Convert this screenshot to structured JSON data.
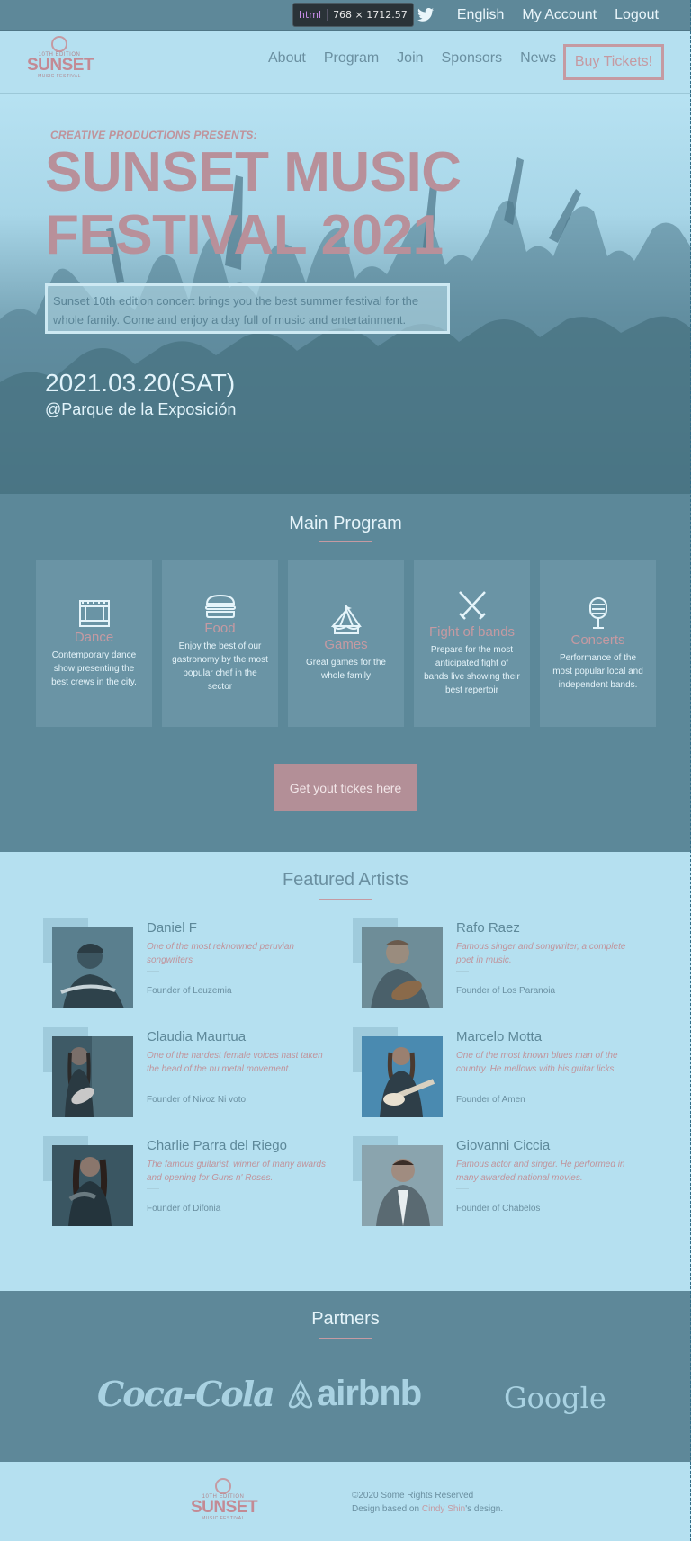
{
  "devtools": {
    "tag": "html",
    "dims": "768 × 1712.57"
  },
  "topbar": {
    "social": [
      "facebook-icon",
      "twitter-icon"
    ],
    "language": "English",
    "account": "My Account",
    "logout": "Logout"
  },
  "logo": {
    "edition": "10TH EDITION",
    "name": "SUNSET",
    "sub": "MUSIC FESTIVAL"
  },
  "nav": {
    "items": [
      "About",
      "Program",
      "Join",
      "Sponsors",
      "News"
    ],
    "buy": "Buy Tickets!"
  },
  "hero": {
    "pre": "CREATIVE PRODUCTIONS PRESENTS:",
    "title_line1": "SUNSET MUSIC",
    "title_line2": "FESTIVAL 2021",
    "blurb": "Sunset 10th edition concert brings you the best summer festival for the whole family. Come and enjoy a day full of music and entertainment.",
    "date": "2021.03.20(SAT)",
    "venue": "@Parque de la Exposición"
  },
  "program": {
    "title": "Main Program",
    "cards": [
      {
        "icon": "stage-icon",
        "title": "Dance",
        "desc": "Contemporary dance show presenting the best crews in the city."
      },
      {
        "icon": "burger-icon",
        "title": "Food",
        "desc": "Enjoy the best of our gastronomy by the most popular chef in the sector"
      },
      {
        "icon": "circus-tent-icon",
        "title": "Games",
        "desc": "Great games for the whole family"
      },
      {
        "icon": "crossed-swords-icon",
        "title": "Fight of bands",
        "desc": "Prepare for the most anticipated fight of bands live showing their best repertoir"
      },
      {
        "icon": "microphone-icon",
        "title": "Concerts",
        "desc": "Performance of the most popular local and independent bands."
      }
    ],
    "cta": "Get yout tickes here"
  },
  "artists": {
    "title": "Featured Artists",
    "items": [
      {
        "name": "Daniel F",
        "desc": "One of the most reknowned peruvian songwriters",
        "founder": "Founder of Leuzemia"
      },
      {
        "name": "Rafo Raez",
        "desc": "Famous singer and songwriter, a complete poet in music.",
        "founder": "Founder of Los Paranoia"
      },
      {
        "name": "Claudia Maurtua",
        "desc": "One of the hardest female voices hast taken the head of the nu metal movement.",
        "founder": "Founder of Nivoz Ni voto"
      },
      {
        "name": "Marcelo Motta",
        "desc": "One of the most known blues man of the country. He mellows with his guitar licks.",
        "founder": "Founder of Amen"
      },
      {
        "name": "Charlie Parra del Riego",
        "desc": "The famous guitarist, winner of many awards and opening for Guns n' Roses.",
        "founder": "Founder of Difonia"
      },
      {
        "name": "Giovanni Ciccia",
        "desc": "Famous actor and singer. He performed in many awarded national movies.",
        "founder": "Founder of Chabelos"
      }
    ]
  },
  "partners": {
    "title": "Partners",
    "logos": [
      "Coca-Cola",
      "airbnb",
      "Google"
    ]
  },
  "footer": {
    "copyright": "©2020 Some Rights Reserved",
    "design_prefix": "Design based on ",
    "design_link": "Cindy Shin",
    "design_suffix": "'s design."
  }
}
